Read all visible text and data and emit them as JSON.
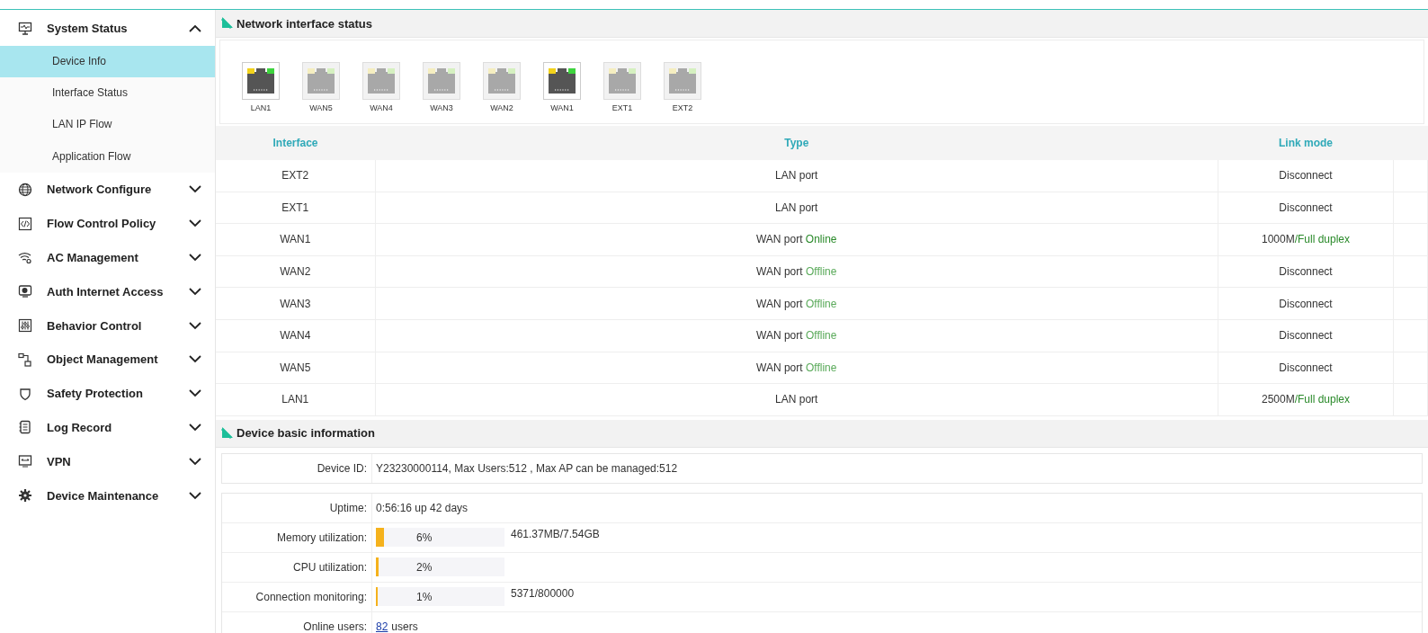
{
  "sidebar": {
    "items": [
      {
        "label": "System Status",
        "expanded": true,
        "children": [
          {
            "label": "Device Info",
            "selected": true
          },
          {
            "label": "Interface Status",
            "selected": false
          },
          {
            "label": "LAN IP Flow",
            "selected": false
          },
          {
            "label": "Application Flow",
            "selected": false
          }
        ]
      },
      {
        "label": "Network Configure",
        "expanded": false
      },
      {
        "label": "Flow Control Policy",
        "expanded": false
      },
      {
        "label": "AC Management",
        "expanded": false
      },
      {
        "label": "Auth Internet Access",
        "expanded": false
      },
      {
        "label": "Behavior Control",
        "expanded": false
      },
      {
        "label": "Object Management",
        "expanded": false
      },
      {
        "label": "Safety Protection",
        "expanded": false
      },
      {
        "label": "Log Record",
        "expanded": false
      },
      {
        "label": "VPN",
        "expanded": false
      },
      {
        "label": "Device Maintenance",
        "expanded": false
      }
    ]
  },
  "interface_panel": {
    "title": "Network interface status",
    "ports": [
      {
        "label": "LAN1",
        "connected": true
      },
      {
        "label": "WAN5",
        "connected": false
      },
      {
        "label": "WAN4",
        "connected": false
      },
      {
        "label": "WAN3",
        "connected": false
      },
      {
        "label": "WAN2",
        "connected": false
      },
      {
        "label": "WAN1",
        "connected": true
      },
      {
        "label": "EXT1",
        "connected": false
      },
      {
        "label": "EXT2",
        "connected": false
      }
    ],
    "table": {
      "columns": [
        "Interface",
        "Type",
        "Link mode"
      ],
      "rows": [
        {
          "interface": "EXT2",
          "type": "LAN port",
          "link": "Disconnect"
        },
        {
          "interface": "EXT1",
          "type": "LAN port",
          "link": "Disconnect"
        },
        {
          "interface": "WAN1",
          "type": "WAN port",
          "status": "Online",
          "online": true,
          "speed": "1000M",
          "duplex": "/Full duplex"
        },
        {
          "interface": "WAN2",
          "type": "WAN port",
          "status": "Offline",
          "online": false,
          "link": "Disconnect"
        },
        {
          "interface": "WAN3",
          "type": "WAN port",
          "status": "Offline",
          "online": false,
          "link": "Disconnect"
        },
        {
          "interface": "WAN4",
          "type": "WAN port",
          "status": "Offline",
          "online": false,
          "link": "Disconnect"
        },
        {
          "interface": "WAN5",
          "type": "WAN port",
          "status": "Offline",
          "online": false,
          "link": "Disconnect"
        },
        {
          "interface": "LAN1",
          "type": "LAN port",
          "speed": "2500M",
          "duplex": "/Full duplex"
        }
      ]
    }
  },
  "device_panel": {
    "title": "Device basic information",
    "device_id": {
      "label": "Device ID:",
      "value": "Y23230000114, Max Users:512 , Max AP can be managed:512"
    },
    "rows": [
      {
        "kind": "text",
        "label": "Uptime:",
        "value": "0:56:16 up 42 days"
      },
      {
        "kind": "meter",
        "label": "Memory utilization:",
        "level": 0.06,
        "reading": "6%",
        "detail": "461.37MB/7.54GB"
      },
      {
        "kind": "meter",
        "label": "CPU utilization:",
        "level": 0.02,
        "reading": "2%"
      },
      {
        "kind": "meter",
        "label": "Connection monitoring:",
        "level": 0.01,
        "reading": "1%",
        "detail": "5371/800000"
      },
      {
        "kind": "link",
        "label": "Online users:",
        "link": "82",
        "value": "users"
      }
    ]
  }
}
